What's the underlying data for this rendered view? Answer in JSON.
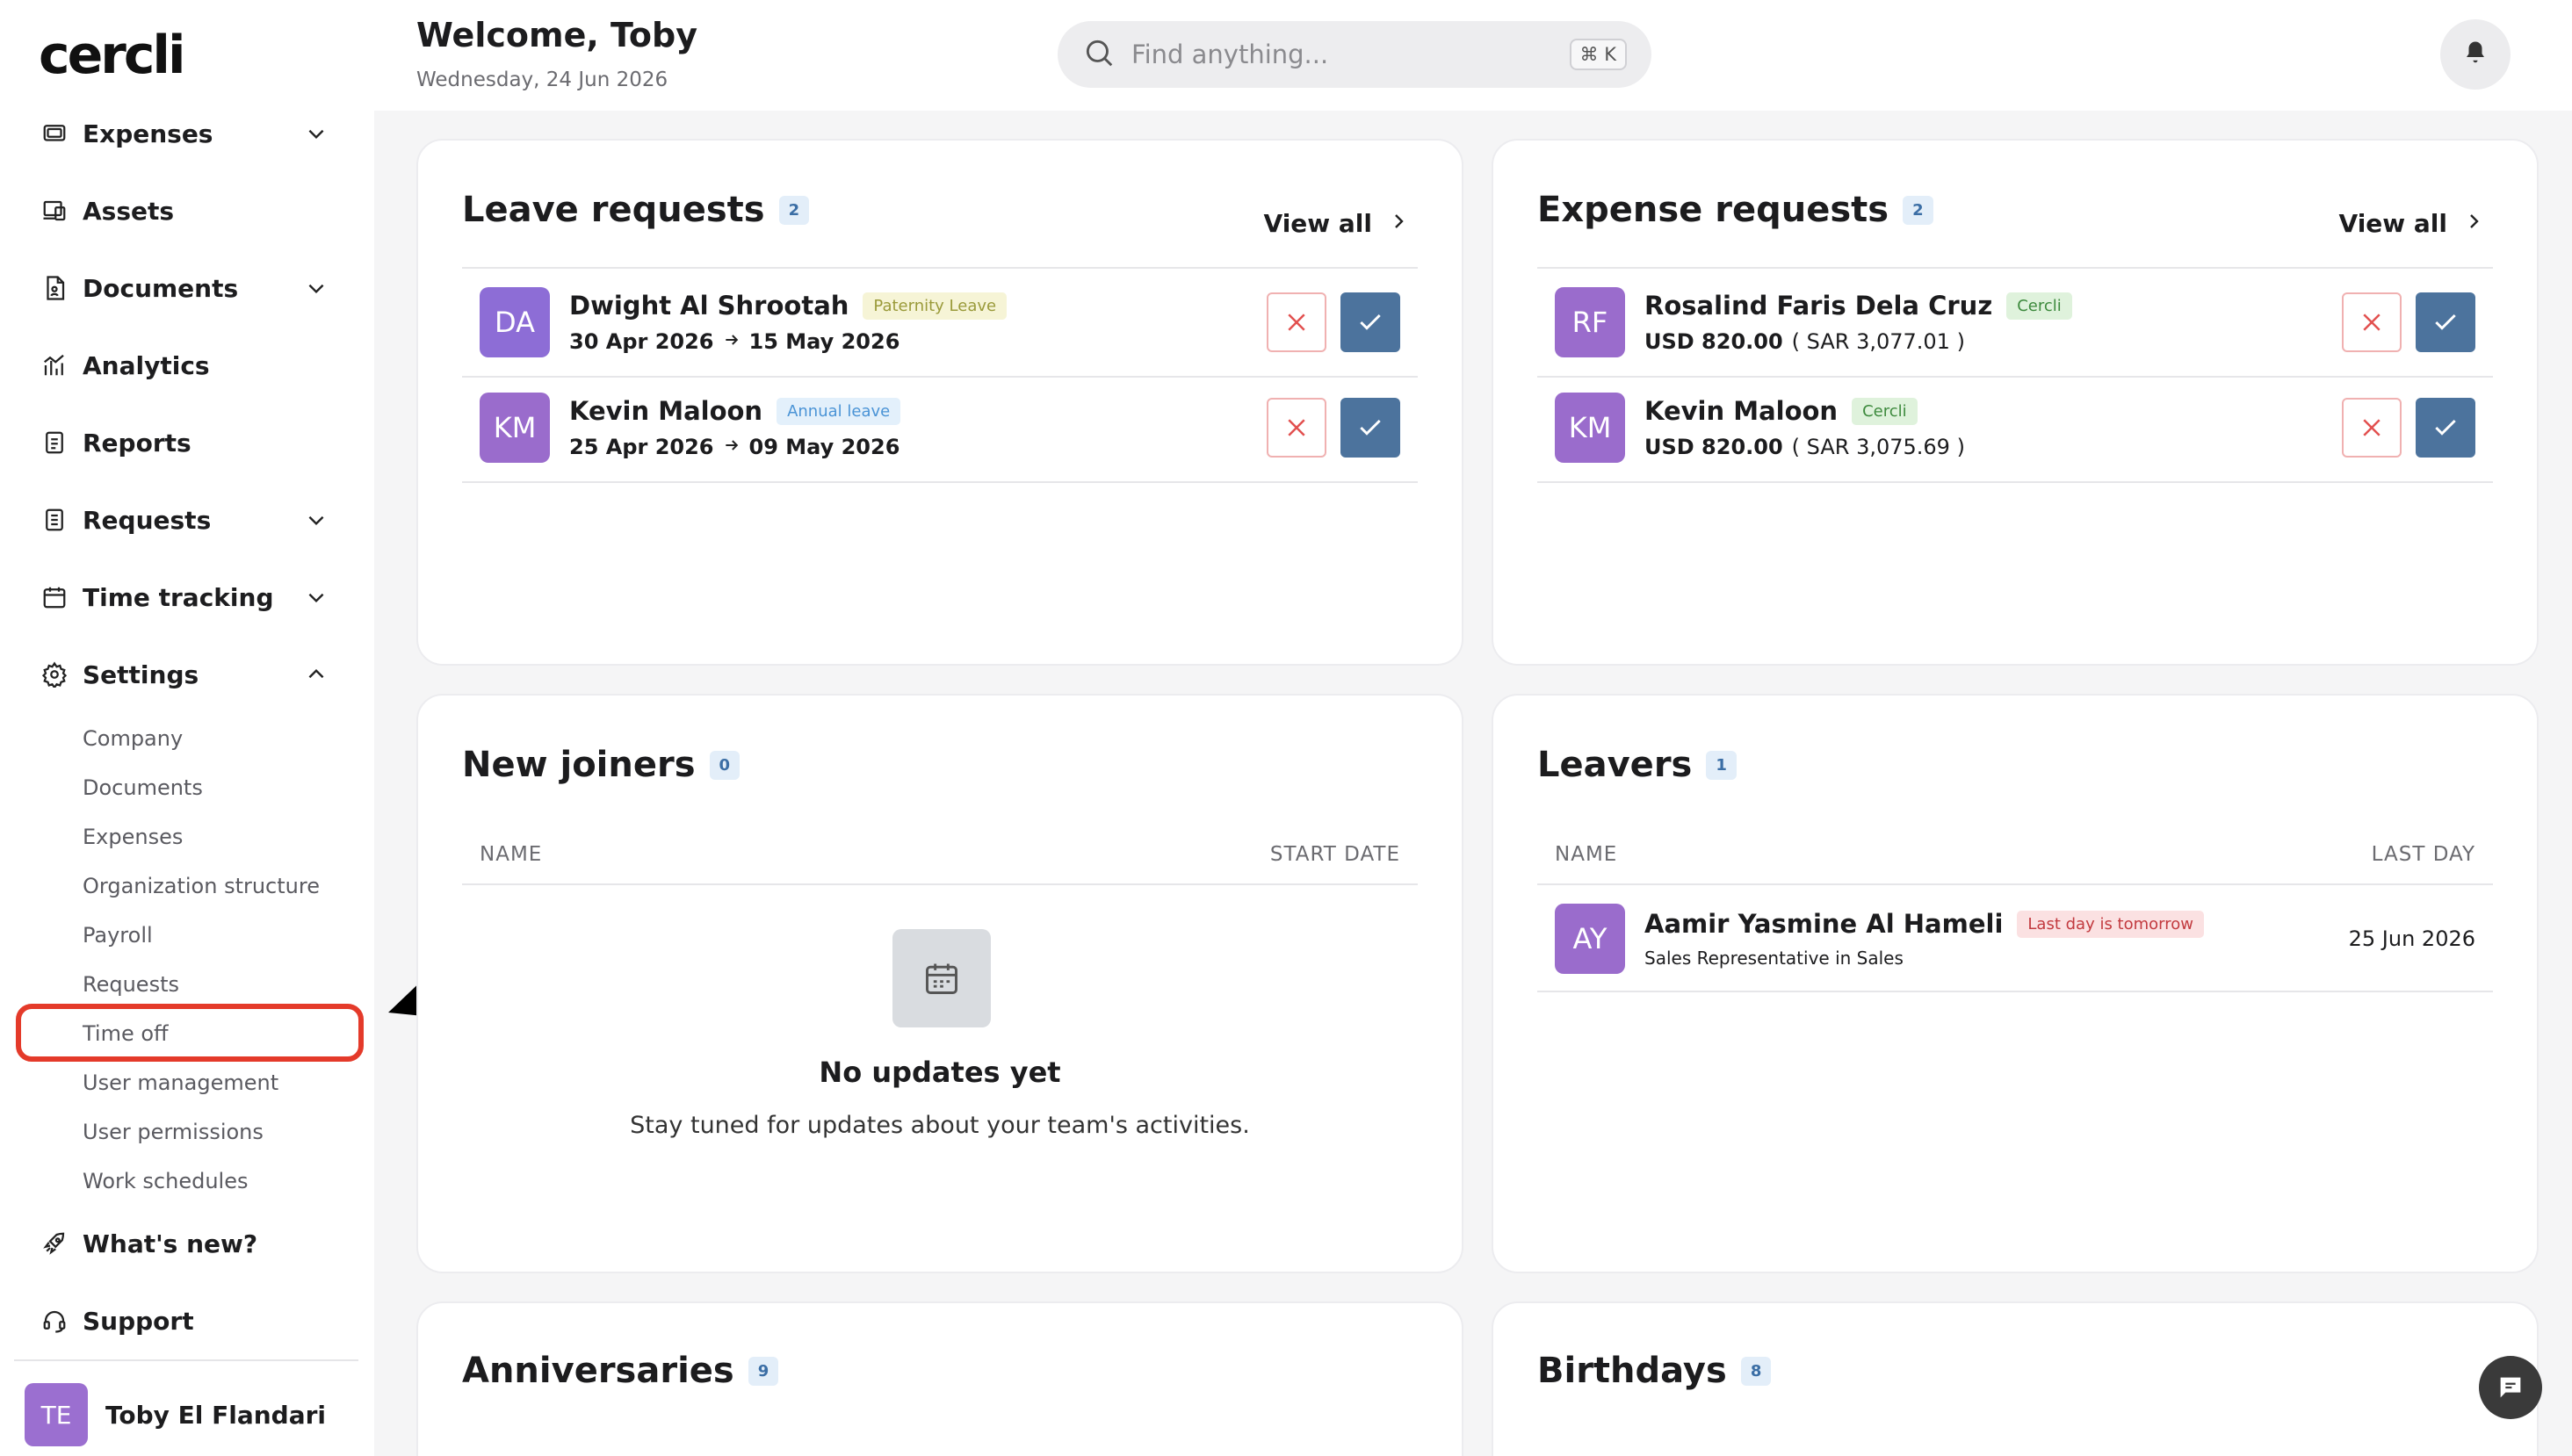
{
  "brand": {
    "logo": "cercli"
  },
  "sidebar": {
    "items": [
      {
        "label": "Expenses",
        "icon": "receipt-icon",
        "expandable": true
      },
      {
        "label": "Assets",
        "icon": "devices-icon",
        "expandable": false
      },
      {
        "label": "Documents",
        "icon": "document-icon",
        "expandable": true
      },
      {
        "label": "Analytics",
        "icon": "analytics-icon",
        "expandable": false
      },
      {
        "label": "Reports",
        "icon": "report-icon",
        "expandable": false
      },
      {
        "label": "Requests",
        "icon": "requests-icon",
        "expandable": true
      },
      {
        "label": "Time tracking",
        "icon": "calendar-icon",
        "expandable": true
      },
      {
        "label": "Settings",
        "icon": "gear-icon",
        "expandable": true,
        "expanded": true
      }
    ],
    "settings_subitems": [
      "Company",
      "Documents",
      "Expenses",
      "Organization structure",
      "Payroll",
      "Requests",
      "Time off",
      "User management",
      "User permissions",
      "Work schedules"
    ],
    "highlighted_subitem": "Time off",
    "bottom_items": [
      {
        "label": "What's new?",
        "icon": "rocket-icon"
      },
      {
        "label": "Support",
        "icon": "headset-icon"
      }
    ],
    "profile": {
      "initials": "TE",
      "name": "Toby El Flandari"
    }
  },
  "header": {
    "welcome": "Welcome, Toby",
    "date": "Wednesday, 24 Jun 2026",
    "search_placeholder": "Find anything...",
    "search_shortcut": "⌘ K"
  },
  "leave_requests": {
    "title": "Leave requests",
    "count": "2",
    "view_all": "View all",
    "rows": [
      {
        "initials": "DA",
        "name": "Dwight Al Shrootah",
        "tag": "Paternity Leave",
        "from": "30 Apr 2026",
        "to": "15 May 2026"
      },
      {
        "initials": "KM",
        "name": "Kevin Maloon",
        "tag": "Annual leave",
        "from": "25 Apr 2026",
        "to": "09 May 2026"
      }
    ]
  },
  "expense_requests": {
    "title": "Expense requests",
    "count": "2",
    "view_all": "View all",
    "rows": [
      {
        "initials": "RF",
        "name": "Rosalind Faris Dela Cruz",
        "tag": "Cercli",
        "amount": "USD 820.00",
        "converted": "( SAR 3,077.01 )"
      },
      {
        "initials": "KM",
        "name": "Kevin Maloon",
        "tag": "Cercli",
        "amount": "USD 820.00",
        "converted": "( SAR 3,075.69 )"
      }
    ]
  },
  "new_joiners": {
    "title": "New joiners",
    "count": "0",
    "col_name": "NAME",
    "col_date": "START DATE",
    "empty_title": "No updates yet",
    "empty_sub": "Stay tuned for updates about your team's activities."
  },
  "leavers": {
    "title": "Leavers",
    "count": "1",
    "col_name": "NAME",
    "col_date": "LAST DAY",
    "rows": [
      {
        "initials": "AY",
        "name": "Aamir Yasmine Al Hameli",
        "tag": "Last day is tomorrow",
        "role": "Sales Representative in Sales",
        "date": "25 Jun 2026"
      }
    ]
  },
  "anniversaries": {
    "title": "Anniversaries",
    "count": "9"
  },
  "birthdays": {
    "title": "Birthdays",
    "count": "8"
  },
  "colors": {
    "accent": "#4c739d",
    "highlight": "#e43a2a",
    "avatar": "#9a6ccc"
  }
}
